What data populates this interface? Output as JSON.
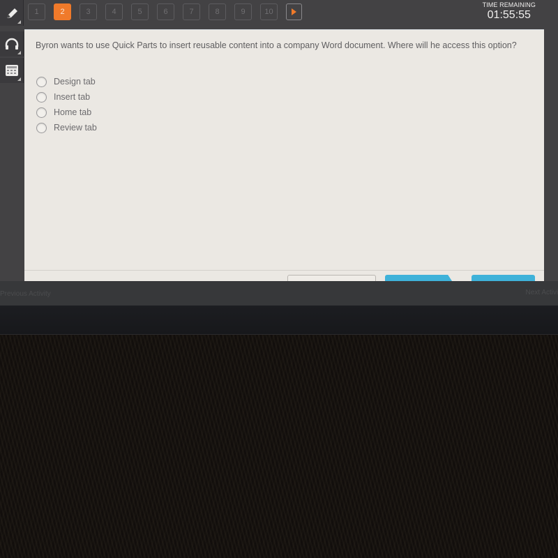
{
  "sidebar": {
    "tools": [
      {
        "name": "pencil",
        "icon": "pencil-icon"
      },
      {
        "name": "audio",
        "icon": "headphones-icon"
      },
      {
        "name": "calculator",
        "icon": "calculator-icon"
      }
    ]
  },
  "question_nav": {
    "items": [
      "1",
      "2",
      "3",
      "4",
      "5",
      "6",
      "7",
      "8",
      "9",
      "10"
    ],
    "active": "2",
    "next_icon": "play-triangle-icon"
  },
  "timer": {
    "label": "TIME REMAINING",
    "value": "01:55:55"
  },
  "question": {
    "text": "Byron wants to use Quick Parts to insert reusable content into a company Word document. Where will he access this option?",
    "choices": [
      "Design tab",
      "Insert tab",
      "Home tab",
      "Review tab"
    ],
    "selected": null
  },
  "status_bar": {
    "previous_label": "Previous Activity",
    "next_label": "Next Activity"
  },
  "colors": {
    "accent": "#f07a2a",
    "button_blue": "#3fb2d9",
    "panel_bg": "#ebe8e3"
  }
}
